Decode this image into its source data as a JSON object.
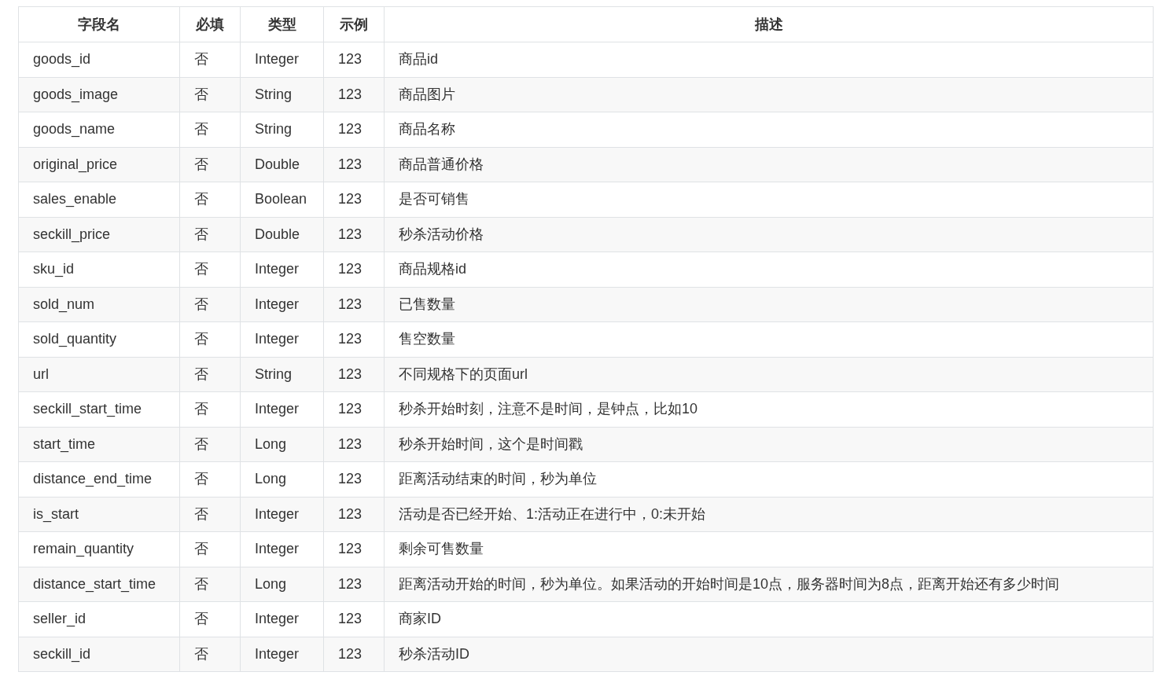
{
  "table": {
    "columns": [
      "字段名",
      "必填",
      "类型",
      "示例",
      "描述"
    ],
    "rows": [
      [
        "goods_id",
        "否",
        "Integer",
        "123",
        "商品id"
      ],
      [
        "goods_image",
        "否",
        "String",
        "123",
        "商品图片"
      ],
      [
        "goods_name",
        "否",
        "String",
        "123",
        "商品名称"
      ],
      [
        "original_price",
        "否",
        "Double",
        "123",
        "商品普通价格"
      ],
      [
        "sales_enable",
        "否",
        "Boolean",
        "123",
        "是否可销售"
      ],
      [
        "seckill_price",
        "否",
        "Double",
        "123",
        "秒杀活动价格"
      ],
      [
        "sku_id",
        "否",
        "Integer",
        "123",
        "商品规格id"
      ],
      [
        "sold_num",
        "否",
        "Integer",
        "123",
        "已售数量"
      ],
      [
        "sold_quantity",
        "否",
        "Integer",
        "123",
        "售空数量"
      ],
      [
        "url",
        "否",
        "String",
        "123",
        "不同规格下的页面url"
      ],
      [
        "seckill_start_time",
        "否",
        "Integer",
        "123",
        "秒杀开始时刻，注意不是时间，是钟点，比如10"
      ],
      [
        "start_time",
        "否",
        "Long",
        "123",
        "秒杀开始时间，这个是时间戳"
      ],
      [
        "distance_end_time",
        "否",
        "Long",
        "123",
        "距离活动结束的时间，秒为单位"
      ],
      [
        "is_start",
        "否",
        "Integer",
        "123",
        "活动是否已经开始、1:活动正在进行中，0:未开始"
      ],
      [
        "remain_quantity",
        "否",
        "Integer",
        "123",
        "剩余可售数量"
      ],
      [
        "distance_start_time",
        "否",
        "Long",
        "123",
        "距离活动开始的时间，秒为单位。如果活动的开始时间是10点，服务器时间为8点，距离开始还有多少时间"
      ],
      [
        "seller_id",
        "否",
        "Integer",
        "123",
        "商家ID"
      ],
      [
        "seckill_id",
        "否",
        "Integer",
        "123",
        "秒杀活动ID"
      ]
    ]
  }
}
